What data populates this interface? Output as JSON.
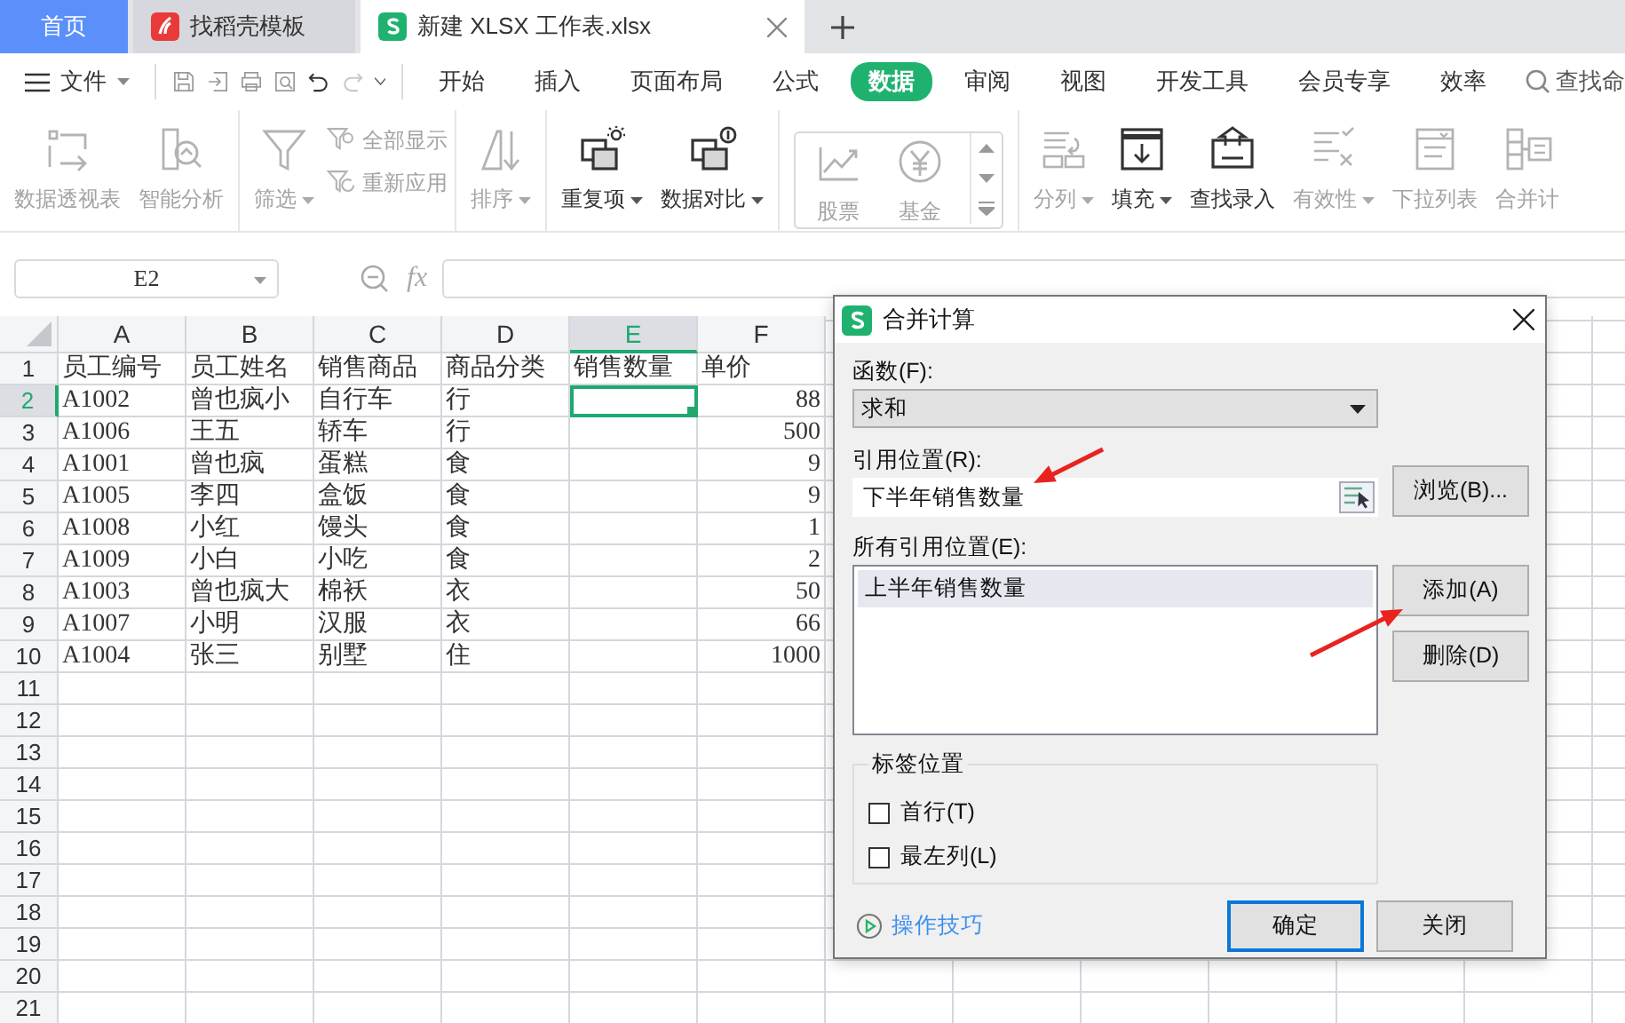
{
  "tabs": [
    {
      "label": "首页",
      "kind": "home",
      "selected": false
    },
    {
      "label": "找稻壳模板",
      "kind": "template",
      "selected": false
    },
    {
      "label": "新建 XLSX 工作表.xlsx",
      "kind": "document",
      "selected": true
    }
  ],
  "menu": {
    "file": "文件",
    "quick_access": [
      {
        "disabled": true
      },
      {
        "disabled": true
      },
      {
        "disabled": true
      },
      {
        "disabled": true
      },
      {
        "disabled": false
      },
      {
        "disabled": true
      }
    ],
    "tabs": [
      {
        "label": "开始",
        "selected": false
      },
      {
        "label": "插入",
        "selected": false
      },
      {
        "label": "页面布局",
        "selected": false
      },
      {
        "label": "公式",
        "selected": false
      },
      {
        "label": "数据",
        "selected": true
      },
      {
        "label": "审阅",
        "selected": false
      },
      {
        "label": "视图",
        "selected": false
      },
      {
        "label": "开发工具",
        "selected": false
      },
      {
        "label": "会员专享",
        "selected": false
      },
      {
        "label": "效率",
        "selected": false
      }
    ],
    "search": "查找命"
  },
  "ribbon": {
    "groups": [
      {
        "kind": "plain",
        "items": [
          {
            "label": "数据透视表",
            "kind": "large",
            "disabled": true,
            "dropdown": false
          },
          {
            "label": "智能分析",
            "kind": "large",
            "disabled": true,
            "dropdown": false
          }
        ]
      },
      {
        "kind": "plain",
        "items": [
          {
            "label": "筛选",
            "kind": "large",
            "disabled": true,
            "dropdown": true
          },
          {
            "label": "全部显示",
            "kind": "small",
            "disabled": true
          },
          {
            "label": "重新应用",
            "kind": "small",
            "disabled": true
          }
        ]
      },
      {
        "kind": "plain",
        "items": [
          {
            "label": "排序",
            "kind": "large",
            "disabled": true,
            "dropdown": true
          }
        ]
      },
      {
        "kind": "plain",
        "items": [
          {
            "label": "重复项",
            "kind": "large",
            "disabled": false,
            "dropdown": true
          },
          {
            "label": "数据对比",
            "kind": "large",
            "disabled": false,
            "dropdown": true
          }
        ]
      },
      {
        "kind": "gallery",
        "items": [
          {
            "label": "股票",
            "kind": "large",
            "disabled": true,
            "dropdown": false
          },
          {
            "label": "基金",
            "kind": "large",
            "disabled": true,
            "dropdown": false
          }
        ]
      },
      {
        "kind": "plain",
        "items": [
          {
            "label": "分列",
            "kind": "large",
            "disabled": true,
            "dropdown": true
          },
          {
            "label": "填充",
            "kind": "large",
            "disabled": false,
            "dropdown": true
          },
          {
            "label": "查找录入",
            "kind": "large",
            "disabled": false,
            "dropdown": false
          },
          {
            "label": "有效性",
            "kind": "large",
            "disabled": true,
            "dropdown": true
          },
          {
            "label": "下拉列表",
            "kind": "large",
            "disabled": true,
            "dropdown": false
          },
          {
            "label": "合并计",
            "kind": "large",
            "disabled": true,
            "dropdown": false
          }
        ]
      }
    ]
  },
  "formula_bar": {
    "cell_ref": "E2",
    "function_label": "fx"
  },
  "sheet": {
    "columns": [
      {
        "letter": "A",
        "selected": false
      },
      {
        "letter": "B",
        "selected": false
      },
      {
        "letter": "C",
        "selected": false
      },
      {
        "letter": "D",
        "selected": false
      },
      {
        "letter": "E",
        "selected": true
      },
      {
        "letter": "F",
        "selected": false
      }
    ],
    "rows": [
      {
        "number": "1",
        "selected": false,
        "cells": [
          {
            "kind": "text",
            "text": "员工编号",
            "selected": false
          },
          {
            "kind": "text",
            "text": "员工姓名",
            "selected": false
          },
          {
            "kind": "text",
            "text": "销售商品",
            "selected": false
          },
          {
            "kind": "text",
            "text": "商品分类",
            "selected": false
          },
          {
            "kind": "text",
            "text": "销售数量",
            "selected": false
          },
          {
            "kind": "text",
            "text": "单价",
            "selected": false
          }
        ]
      },
      {
        "number": "2",
        "selected": true,
        "cells": [
          {
            "kind": "text",
            "text": "A1002",
            "selected": false
          },
          {
            "kind": "text",
            "text": "曾也疯小",
            "selected": false
          },
          {
            "kind": "text",
            "text": "自行车",
            "selected": false
          },
          {
            "kind": "text",
            "text": "行",
            "selected": false
          },
          {
            "kind": "empty",
            "selected": true
          },
          {
            "kind": "number",
            "text": "88",
            "selected": false
          }
        ]
      },
      {
        "number": "3",
        "selected": false,
        "cells": [
          {
            "kind": "text",
            "text": "A1006",
            "selected": false
          },
          {
            "kind": "text",
            "text": "王五",
            "selected": false
          },
          {
            "kind": "text",
            "text": "轿车",
            "selected": false
          },
          {
            "kind": "text",
            "text": "行",
            "selected": false
          },
          {
            "kind": "empty",
            "selected": false
          },
          {
            "kind": "number",
            "text": "500",
            "selected": false
          }
        ]
      },
      {
        "number": "4",
        "selected": false,
        "cells": [
          {
            "kind": "text",
            "text": "A1001",
            "selected": false
          },
          {
            "kind": "text",
            "text": "曾也疯",
            "selected": false
          },
          {
            "kind": "text",
            "text": "蛋糕",
            "selected": false
          },
          {
            "kind": "text",
            "text": "食",
            "selected": false
          },
          {
            "kind": "empty",
            "selected": false
          },
          {
            "kind": "number",
            "text": "9",
            "selected": false
          }
        ]
      },
      {
        "number": "5",
        "selected": false,
        "cells": [
          {
            "kind": "text",
            "text": "A1005",
            "selected": false
          },
          {
            "kind": "text",
            "text": "李四",
            "selected": false
          },
          {
            "kind": "text",
            "text": "盒饭",
            "selected": false
          },
          {
            "kind": "text",
            "text": "食",
            "selected": false
          },
          {
            "kind": "empty",
            "selected": false
          },
          {
            "kind": "number",
            "text": "9",
            "selected": false
          }
        ]
      },
      {
        "number": "6",
        "selected": false,
        "cells": [
          {
            "kind": "text",
            "text": "A1008",
            "selected": false
          },
          {
            "kind": "text",
            "text": "小红",
            "selected": false
          },
          {
            "kind": "text",
            "text": "馒头",
            "selected": false
          },
          {
            "kind": "text",
            "text": "食",
            "selected": false
          },
          {
            "kind": "empty",
            "selected": false
          },
          {
            "kind": "number",
            "text": "1",
            "selected": false
          }
        ]
      },
      {
        "number": "7",
        "selected": false,
        "cells": [
          {
            "kind": "text",
            "text": "A1009",
            "selected": false
          },
          {
            "kind": "text",
            "text": "小白",
            "selected": false
          },
          {
            "kind": "text",
            "text": "小吃",
            "selected": false
          },
          {
            "kind": "text",
            "text": "食",
            "selected": false
          },
          {
            "kind": "empty",
            "selected": false
          },
          {
            "kind": "number",
            "text": "2",
            "selected": false
          }
        ]
      },
      {
        "number": "8",
        "selected": false,
        "cells": [
          {
            "kind": "text",
            "text": "A1003",
            "selected": false
          },
          {
            "kind": "text",
            "text": "曾也疯大",
            "selected": false
          },
          {
            "kind": "text",
            "text": "棉袄",
            "selected": false
          },
          {
            "kind": "text",
            "text": "衣",
            "selected": false
          },
          {
            "kind": "empty",
            "selected": false
          },
          {
            "kind": "number",
            "text": "50",
            "selected": false
          }
        ]
      },
      {
        "number": "9",
        "selected": false,
        "cells": [
          {
            "kind": "text",
            "text": "A1007",
            "selected": false
          },
          {
            "kind": "text",
            "text": "小明",
            "selected": false
          },
          {
            "kind": "text",
            "text": "汉服",
            "selected": false
          },
          {
            "kind": "text",
            "text": "衣",
            "selected": false
          },
          {
            "kind": "empty",
            "selected": false
          },
          {
            "kind": "number",
            "text": "66",
            "selected": false
          }
        ]
      },
      {
        "number": "10",
        "selected": false,
        "cells": [
          {
            "kind": "text",
            "text": "A1004",
            "selected": false
          },
          {
            "kind": "text",
            "text": "张三",
            "selected": false
          },
          {
            "kind": "text",
            "text": "别墅",
            "selected": false
          },
          {
            "kind": "text",
            "text": "住",
            "selected": false
          },
          {
            "kind": "empty",
            "selected": false
          },
          {
            "kind": "number",
            "text": "1000",
            "selected": false
          }
        ]
      },
      {
        "number": "11",
        "selected": false
      },
      {
        "number": "12",
        "selected": false
      },
      {
        "number": "13",
        "selected": false
      },
      {
        "number": "14",
        "selected": false
      },
      {
        "number": "15",
        "selected": false
      },
      {
        "number": "16",
        "selected": false
      },
      {
        "number": "17",
        "selected": false
      },
      {
        "number": "18",
        "selected": false
      },
      {
        "number": "19",
        "selected": false
      },
      {
        "number": "20",
        "selected": false
      },
      {
        "number": "21",
        "selected": false
      }
    ]
  },
  "dialog": {
    "title": "合并计算",
    "function_label": "函数(F):",
    "function_value": "求和",
    "reference_label": "引用位置(R):",
    "reference_value": "下半年销售数量",
    "browse_button": "浏览(B)...",
    "all_references_label": "所有引用位置(E):",
    "all_references": [
      {
        "label": "上半年销售数量",
        "selected": true
      }
    ],
    "add_button": "添加(A)",
    "delete_button": "删除(D)",
    "label_position": {
      "title": "标签位置",
      "options": [
        {
          "label": "首行(T)",
          "checked": false
        },
        {
          "label": "最左列(L)",
          "checked": false
        }
      ]
    },
    "tips_link": "操作技巧",
    "buttons": [
      {
        "label": "确定",
        "focused": true
      },
      {
        "label": "关闭",
        "focused": false
      }
    ]
  }
}
